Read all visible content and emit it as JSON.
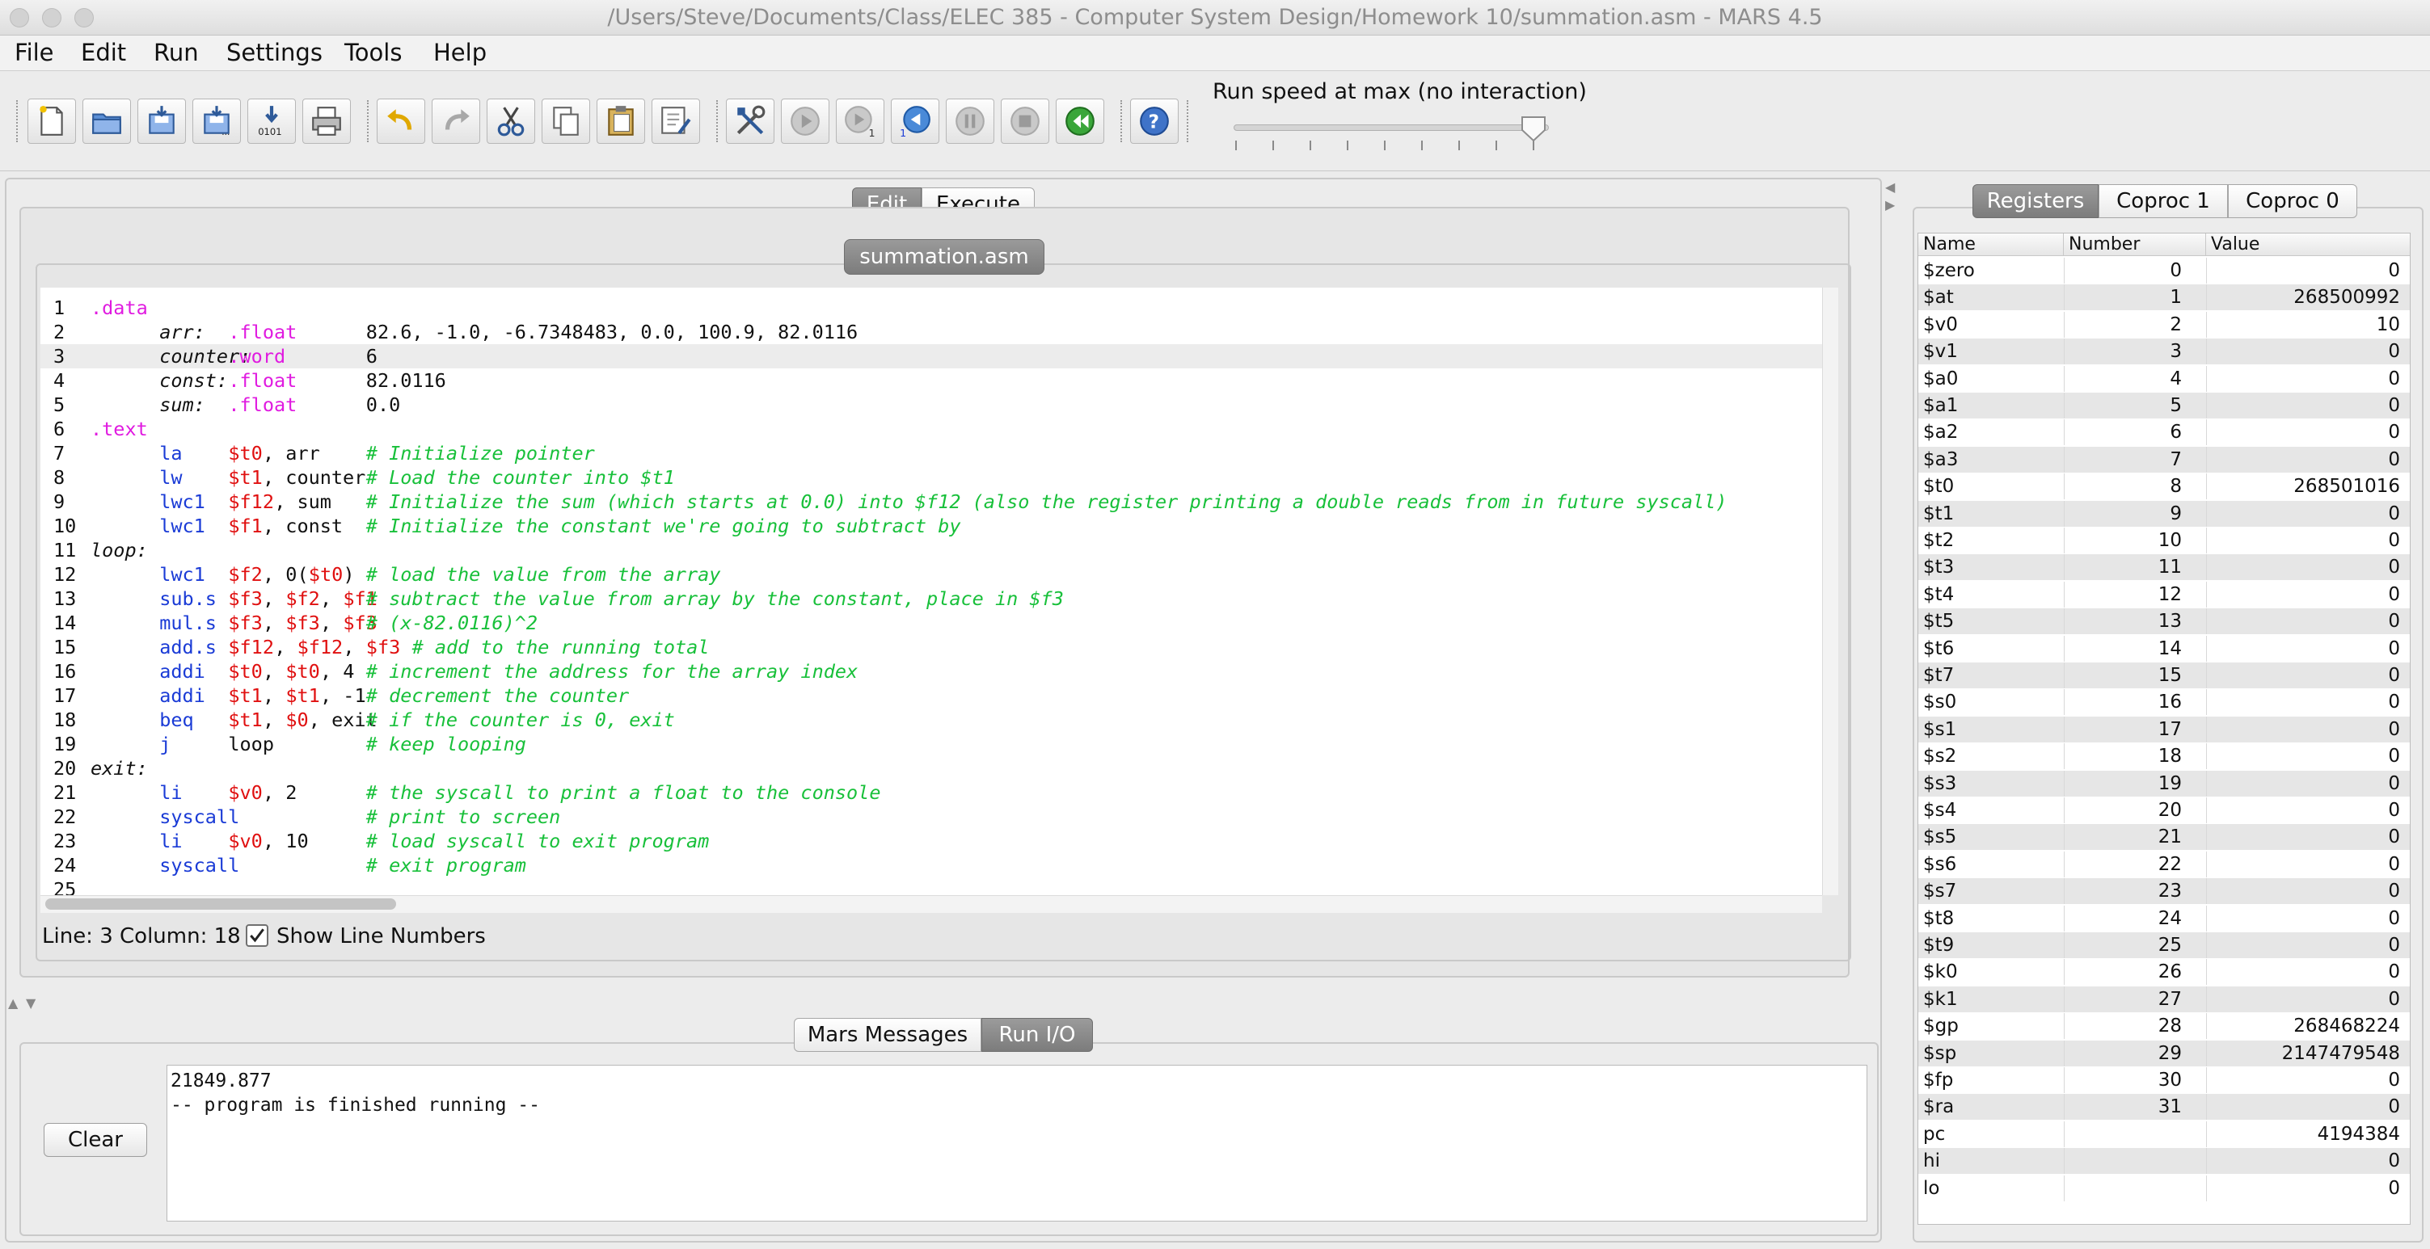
{
  "window": {
    "title": "/Users/Steve/Documents/Class/ELEC 385 - Computer System Design/Homework 10/summation.asm  - MARS 4.5"
  },
  "menu": [
    "File",
    "Edit",
    "Run",
    "Settings",
    "Tools",
    "Help"
  ],
  "toolbar": {
    "buttons": [
      "new",
      "open",
      "save",
      "save-as",
      "dump-memory",
      "print",
      "undo",
      "redo",
      "cut",
      "copy",
      "paste",
      "find-replace",
      "assemble",
      "run",
      "step",
      "backstep",
      "pause",
      "stop",
      "reset",
      "help"
    ],
    "binary_label": "0101",
    "step_badge": "1",
    "speed_label": "Run speed at max (no interaction)"
  },
  "modes": {
    "edit": "Edit",
    "execute": "Execute",
    "selected": "Edit"
  },
  "editor": {
    "file_tab": "summation.asm",
    "lines": [
      {
        "n": "1",
        "tokens": [
          {
            "c": 0,
            "t": ".data",
            "k": "dir"
          }
        ]
      },
      {
        "n": "2",
        "tokens": [
          {
            "c": 6,
            "t": "arr:",
            "k": "lbl"
          },
          {
            "c": 12,
            "t": ".float",
            "k": "dir"
          },
          {
            "c": 24,
            "t": "82.6, -1.0, -6.7348483, 0.0, 100.9, 82.0116",
            "k": "txt"
          }
        ]
      },
      {
        "n": "3",
        "tokens": [
          {
            "c": 6,
            "t": "counter:",
            "k": "lbl"
          },
          {
            "c": 12,
            "t": ".word",
            "k": "dir"
          },
          {
            "c": 24,
            "t": "6",
            "k": "txt"
          }
        ]
      },
      {
        "n": "4",
        "tokens": [
          {
            "c": 6,
            "t": "const:",
            "k": "lbl"
          },
          {
            "c": 12,
            "t": ".float",
            "k": "dir"
          },
          {
            "c": 24,
            "t": "82.0116",
            "k": "txt"
          }
        ]
      },
      {
        "n": "5",
        "tokens": [
          {
            "c": 6,
            "t": "sum:",
            "k": "lbl"
          },
          {
            "c": 12,
            "t": ".float",
            "k": "dir"
          },
          {
            "c": 24,
            "t": "0.0",
            "k": "txt"
          }
        ]
      },
      {
        "n": "6",
        "tokens": [
          {
            "c": 0,
            "t": ".text",
            "k": "dir"
          }
        ]
      },
      {
        "n": "7",
        "tokens": [
          {
            "c": 6,
            "t": "la",
            "k": "ins"
          },
          {
            "c": 12,
            "t": "$t0",
            "k": "reg"
          },
          {
            "c": 15,
            "t": ", arr",
            "k": "txt"
          },
          {
            "c": 24,
            "t": "# Initialize pointer",
            "k": "cmt"
          }
        ]
      },
      {
        "n": "8",
        "tokens": [
          {
            "c": 6,
            "t": "lw",
            "k": "ins"
          },
          {
            "c": 12,
            "t": "$t1",
            "k": "reg"
          },
          {
            "c": 15,
            "t": ", counter",
            "k": "txt"
          },
          {
            "c": 24,
            "t": "# Load the counter into $t1",
            "k": "cmt"
          }
        ]
      },
      {
        "n": "9",
        "tokens": [
          {
            "c": 6,
            "t": "lwc1",
            "k": "ins"
          },
          {
            "c": 12,
            "t": "$f12",
            "k": "reg"
          },
          {
            "c": 16,
            "t": ", sum",
            "k": "txt"
          },
          {
            "c": 24,
            "t": "# Initialize the sum (which starts at 0.0) into $f12 (also the register printing a double reads from in future syscall)",
            "k": "cmt"
          }
        ]
      },
      {
        "n": "10",
        "tokens": [
          {
            "c": 6,
            "t": "lwc1",
            "k": "ins"
          },
          {
            "c": 12,
            "t": "$f1",
            "k": "reg"
          },
          {
            "c": 15,
            "t": ", const",
            "k": "txt"
          },
          {
            "c": 24,
            "t": "# Initialize the constant we're going to subtract by",
            "k": "cmt"
          }
        ]
      },
      {
        "n": "11",
        "tokens": [
          {
            "c": 0,
            "t": "loop:",
            "k": "lbl"
          }
        ]
      },
      {
        "n": "12",
        "tokens": [
          {
            "c": 6,
            "t": "lwc1",
            "k": "ins"
          },
          {
            "c": 12,
            "t": "$f2",
            "k": "reg"
          },
          {
            "c": 15,
            "t": ", 0(",
            "k": "txt"
          },
          {
            "c": 19,
            "t": "$t0",
            "k": "reg"
          },
          {
            "c": 22,
            "t": ")",
            "k": "txt"
          },
          {
            "c": 24,
            "t": "# load the value from the array",
            "k": "cmt"
          }
        ]
      },
      {
        "n": "13",
        "tokens": [
          {
            "c": 6,
            "t": "sub.s",
            "k": "ins"
          },
          {
            "c": 12,
            "t": "$f3",
            "k": "reg"
          },
          {
            "c": 15,
            "t": ", ",
            "k": "txt"
          },
          {
            "c": 17,
            "t": "$f2",
            "k": "reg"
          },
          {
            "c": 20,
            "t": ", ",
            "k": "txt"
          },
          {
            "c": 22,
            "t": "$f1",
            "k": "reg"
          },
          {
            "c": 24,
            "t": "# subtract the value from array by the constant, place in $f3",
            "k": "cmt"
          }
        ]
      },
      {
        "n": "14",
        "tokens": [
          {
            "c": 6,
            "t": "mul.s",
            "k": "ins"
          },
          {
            "c": 12,
            "t": "$f3",
            "k": "reg"
          },
          {
            "c": 15,
            "t": ", ",
            "k": "txt"
          },
          {
            "c": 17,
            "t": "$f3",
            "k": "reg"
          },
          {
            "c": 20,
            "t": ", ",
            "k": "txt"
          },
          {
            "c": 22,
            "t": "$f3",
            "k": "reg"
          },
          {
            "c": 24,
            "t": "# (x-82.0116)^2",
            "k": "cmt"
          }
        ]
      },
      {
        "n": "15",
        "tokens": [
          {
            "c": 6,
            "t": "add.s",
            "k": "ins"
          },
          {
            "c": 12,
            "t": "$f12",
            "k": "reg"
          },
          {
            "c": 16,
            "t": ", ",
            "k": "txt"
          },
          {
            "c": 18,
            "t": "$f12",
            "k": "reg"
          },
          {
            "c": 22,
            "t": ", ",
            "k": "txt"
          },
          {
            "c": 24,
            "t": "$f3",
            "k": "reg"
          },
          {
            "c": 28,
            "t": "# add to the running total",
            "k": "cmt"
          }
        ]
      },
      {
        "n": "16",
        "tokens": [
          {
            "c": 6,
            "t": "addi",
            "k": "ins"
          },
          {
            "c": 12,
            "t": "$t0",
            "k": "reg"
          },
          {
            "c": 15,
            "t": ", ",
            "k": "txt"
          },
          {
            "c": 17,
            "t": "$t0",
            "k": "reg"
          },
          {
            "c": 20,
            "t": ", 4",
            "k": "txt"
          },
          {
            "c": 24,
            "t": "# increment the address for the array index",
            "k": "cmt"
          }
        ]
      },
      {
        "n": "17",
        "tokens": [
          {
            "c": 6,
            "t": "addi",
            "k": "ins"
          },
          {
            "c": 12,
            "t": "$t1",
            "k": "reg"
          },
          {
            "c": 15,
            "t": ", ",
            "k": "txt"
          },
          {
            "c": 17,
            "t": "$t1",
            "k": "reg"
          },
          {
            "c": 20,
            "t": ", -1",
            "k": "txt"
          },
          {
            "c": 24,
            "t": "# decrement the counter",
            "k": "cmt"
          }
        ]
      },
      {
        "n": "18",
        "tokens": [
          {
            "c": 6,
            "t": "beq",
            "k": "ins"
          },
          {
            "c": 12,
            "t": "$t1",
            "k": "reg"
          },
          {
            "c": 15,
            "t": ", ",
            "k": "txt"
          },
          {
            "c": 17,
            "t": "$0",
            "k": "reg"
          },
          {
            "c": 19,
            "t": ", exit",
            "k": "txt"
          },
          {
            "c": 24,
            "t": "# if the counter is 0, exit",
            "k": "cmt"
          }
        ]
      },
      {
        "n": "19",
        "tokens": [
          {
            "c": 6,
            "t": "j",
            "k": "ins"
          },
          {
            "c": 12,
            "t": "loop",
            "k": "txt"
          },
          {
            "c": 24,
            "t": "# keep looping",
            "k": "cmt"
          }
        ]
      },
      {
        "n": "20",
        "tokens": [
          {
            "c": 0,
            "t": "exit:",
            "k": "lbl"
          }
        ]
      },
      {
        "n": "21",
        "tokens": [
          {
            "c": 6,
            "t": "li",
            "k": "ins"
          },
          {
            "c": 12,
            "t": "$v0",
            "k": "reg"
          },
          {
            "c": 15,
            "t": ", 2",
            "k": "txt"
          },
          {
            "c": 24,
            "t": "# the syscall to print a float to the console",
            "k": "cmt"
          }
        ]
      },
      {
        "n": "22",
        "tokens": [
          {
            "c": 6,
            "t": "syscall",
            "k": "ins"
          },
          {
            "c": 24,
            "t": "# print to screen",
            "k": "cmt"
          }
        ]
      },
      {
        "n": "23",
        "tokens": [
          {
            "c": 6,
            "t": "li",
            "k": "ins"
          },
          {
            "c": 12,
            "t": "$v0",
            "k": "reg"
          },
          {
            "c": 15,
            "t": ", 10",
            "k": "txt"
          },
          {
            "c": 24,
            "t": "# load syscall to exit program",
            "k": "cmt"
          }
        ]
      },
      {
        "n": "24",
        "tokens": [
          {
            "c": 6,
            "t": "syscall",
            "k": "ins"
          },
          {
            "c": 24,
            "t": "# exit program",
            "k": "cmt"
          }
        ]
      },
      {
        "n": "25",
        "tokens": []
      }
    ],
    "current_line": "3",
    "status": "Line: 3 Column: 18",
    "show_line_numbers_label": "Show Line Numbers",
    "show_line_numbers_checked": true,
    "colors": {
      "directive": "#e01be0",
      "instruction": "#1a3bd6",
      "register": "#e01010",
      "comment": "#18c03a"
    }
  },
  "messages": {
    "tabs": [
      "Mars Messages",
      "Run I/O"
    ],
    "selected": "Run I/O",
    "output": [
      "21849.877",
      "-- program is finished running --"
    ],
    "clear_label": "Clear"
  },
  "registers": {
    "tabs": [
      "Registers",
      "Coproc 1",
      "Coproc 0"
    ],
    "selected": "Registers",
    "columns": [
      "Name",
      "Number",
      "Value"
    ],
    "rows": [
      [
        "$zero",
        "0",
        "0"
      ],
      [
        "$at",
        "1",
        "268500992"
      ],
      [
        "$v0",
        "2",
        "10"
      ],
      [
        "$v1",
        "3",
        "0"
      ],
      [
        "$a0",
        "4",
        "0"
      ],
      [
        "$a1",
        "5",
        "0"
      ],
      [
        "$a2",
        "6",
        "0"
      ],
      [
        "$a3",
        "7",
        "0"
      ],
      [
        "$t0",
        "8",
        "268501016"
      ],
      [
        "$t1",
        "9",
        "0"
      ],
      [
        "$t2",
        "10",
        "0"
      ],
      [
        "$t3",
        "11",
        "0"
      ],
      [
        "$t4",
        "12",
        "0"
      ],
      [
        "$t5",
        "13",
        "0"
      ],
      [
        "$t6",
        "14",
        "0"
      ],
      [
        "$t7",
        "15",
        "0"
      ],
      [
        "$s0",
        "16",
        "0"
      ],
      [
        "$s1",
        "17",
        "0"
      ],
      [
        "$s2",
        "18",
        "0"
      ],
      [
        "$s3",
        "19",
        "0"
      ],
      [
        "$s4",
        "20",
        "0"
      ],
      [
        "$s5",
        "21",
        "0"
      ],
      [
        "$s6",
        "22",
        "0"
      ],
      [
        "$s7",
        "23",
        "0"
      ],
      [
        "$t8",
        "24",
        "0"
      ],
      [
        "$t9",
        "25",
        "0"
      ],
      [
        "$k0",
        "26",
        "0"
      ],
      [
        "$k1",
        "27",
        "0"
      ],
      [
        "$gp",
        "28",
        "268468224"
      ],
      [
        "$sp",
        "29",
        "2147479548"
      ],
      [
        "$fp",
        "30",
        "0"
      ],
      [
        "$ra",
        "31",
        "0"
      ],
      [
        "pc",
        "",
        "4194384"
      ],
      [
        "hi",
        "",
        "0"
      ],
      [
        "lo",
        "",
        "0"
      ]
    ]
  }
}
